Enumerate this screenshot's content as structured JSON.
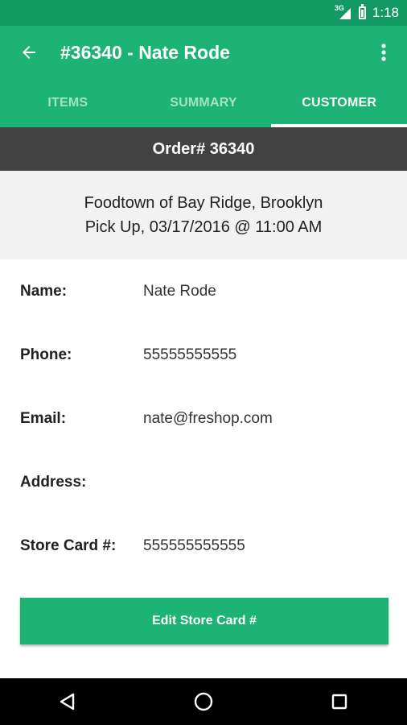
{
  "status_bar": {
    "network": "3G",
    "time": "1:18"
  },
  "toolbar": {
    "title": "#36340 - Nate Rode",
    "back_icon": "arrow-left-icon",
    "more_icon": "more-vert-icon"
  },
  "tabs": [
    {
      "label": "ITEMS",
      "active": false
    },
    {
      "label": "SUMMARY",
      "active": false
    },
    {
      "label": "CUSTOMER",
      "active": true
    }
  ],
  "order": {
    "header": "Order# 36340"
  },
  "store": {
    "line1": "Foodtown of Bay Ridge, Brooklyn",
    "line2": "Pick Up, 03/17/2016 @ 11:00 AM"
  },
  "customer": {
    "name_label": "Name:",
    "name_value": "Nate Rode",
    "phone_label": "Phone:",
    "phone_value": "55555555555",
    "email_label": "Email:",
    "email_value": "nate@freshop.com",
    "address_label": "Address:",
    "address_value": "",
    "store_card_label": "Store Card #:",
    "store_card_value": "555555555555"
  },
  "actions": {
    "edit_store_card_label": "Edit Store Card #"
  },
  "colors": {
    "primary": "#1db375",
    "primary_dark": "#139a63",
    "order_bar": "#424242",
    "store_bg": "#f2f2f2"
  }
}
